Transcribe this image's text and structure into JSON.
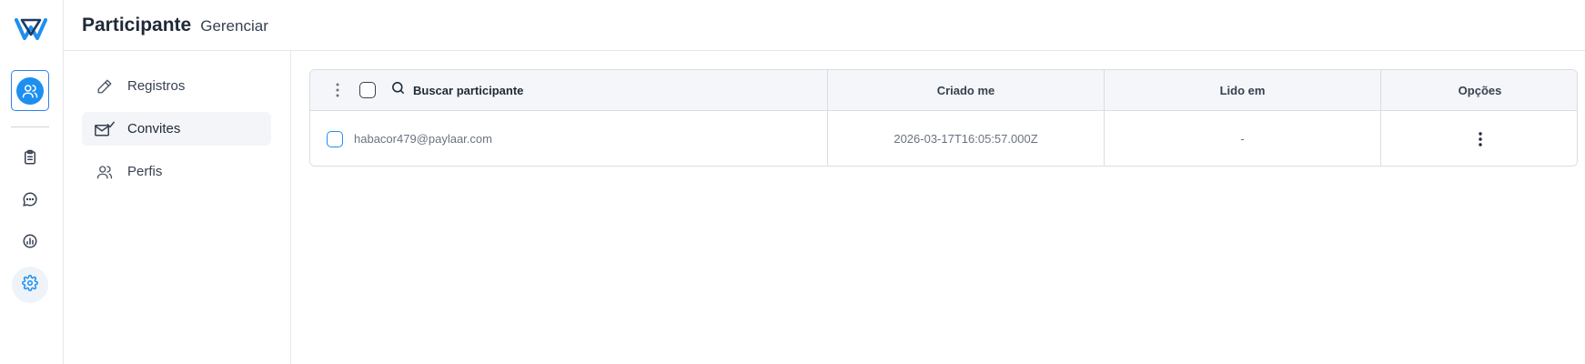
{
  "header": {
    "title": "Participante",
    "subtitle": "Gerenciar"
  },
  "rail": {
    "active_item": "users-icon",
    "items": [
      "clipboard-icon",
      "chat-icon",
      "analytics-icon",
      "gear-icon"
    ],
    "accent": "#1d8ff0"
  },
  "subnav": {
    "items": [
      {
        "label": "Registros",
        "icon": "pencil-icon",
        "active": false
      },
      {
        "label": "Convites",
        "icon": "mail-check-icon",
        "active": true
      },
      {
        "label": "Perfis",
        "icon": "users-icon",
        "active": false
      }
    ]
  },
  "table": {
    "search": {
      "placeholder": "Buscar participante"
    },
    "columns": [
      "Criado me",
      "Lido em",
      "Opções"
    ],
    "rows": [
      {
        "email": "habacor479@paylaar.com",
        "created": "2026-03-17T16:05:57.000Z",
        "read": "-"
      }
    ]
  }
}
